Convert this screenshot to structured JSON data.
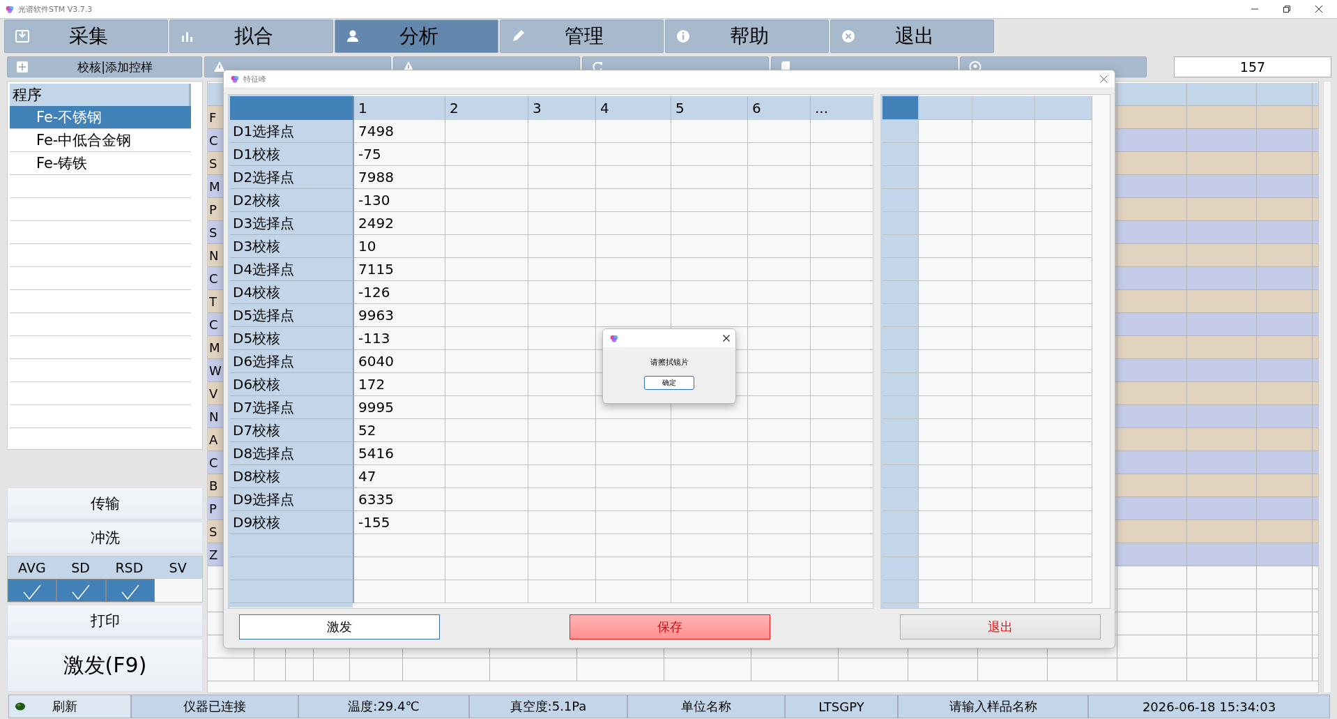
{
  "window": {
    "title": "光谱软件STM V3.7.3"
  },
  "main_tabs": [
    {
      "label": "采集",
      "selected": false
    },
    {
      "label": "拟合",
      "selected": false
    },
    {
      "label": "分析",
      "selected": true
    },
    {
      "label": "管理",
      "selected": false
    },
    {
      "label": "帮助",
      "selected": false
    },
    {
      "label": "退出",
      "selected": false
    }
  ],
  "toolbar": {
    "add_button": "校核|添加控样",
    "count": "157"
  },
  "program_list": {
    "header": "程序",
    "items": [
      {
        "label": "Fe-不锈钢",
        "selected": true
      },
      {
        "label": "Fe-中低合金钢",
        "selected": false
      },
      {
        "label": "Fe-铸铁",
        "selected": false
      }
    ]
  },
  "actions": [
    "传输",
    "冲洗"
  ],
  "stats": [
    {
      "label": "AVG",
      "checked": true
    },
    {
      "label": "SD",
      "checked": true
    },
    {
      "label": "RSD",
      "checked": true
    },
    {
      "label": "SV",
      "checked": false
    }
  ],
  "actions_lower": [
    "打印",
    "激发(F9)"
  ],
  "element_grid": {
    "row_labels": [
      "F",
      "C",
      "S",
      "M",
      "P",
      "S",
      "N",
      "C",
      "T",
      "C",
      "M",
      "W",
      "V",
      "N",
      "A",
      "C",
      "B",
      "P",
      "S",
      "Z"
    ]
  },
  "status_bar": {
    "refresh": "刷新",
    "items": [
      "仪器已连接",
      "温度:29.4℃",
      "真空度:5.1Pa",
      "单位名称",
      "LTSGPY",
      "请输入样品名称",
      "2026-06-18 15:34:03"
    ]
  },
  "peak_dialog": {
    "title": "特征峰",
    "columns": [
      "1",
      "2",
      "3",
      "4",
      "5",
      "6",
      "..."
    ],
    "rows": [
      {
        "label": "D1选择点",
        "value": "7498"
      },
      {
        "label": "D1校核",
        "value": "-75"
      },
      {
        "label": "D2选择点",
        "value": "7988"
      },
      {
        "label": "D2校核",
        "value": "-130"
      },
      {
        "label": "D3选择点",
        "value": "2492"
      },
      {
        "label": "D3校核",
        "value": "10"
      },
      {
        "label": "D4选择点",
        "value": "7115"
      },
      {
        "label": "D4校核",
        "value": "-126"
      },
      {
        "label": "D5选择点",
        "value": "9963"
      },
      {
        "label": "D5校核",
        "value": "-113"
      },
      {
        "label": "D6选择点",
        "value": "6040"
      },
      {
        "label": "D6校核",
        "value": "172"
      },
      {
        "label": "D7选择点",
        "value": "9995"
      },
      {
        "label": "D7校核",
        "value": "52"
      },
      {
        "label": "D8选择点",
        "value": "5416"
      },
      {
        "label": "D8校核",
        "value": "47"
      },
      {
        "label": "D9选择点",
        "value": "6335"
      },
      {
        "label": "D9校核",
        "value": "-155"
      }
    ],
    "buttons": [
      {
        "label": "激发",
        "kind": "plain"
      },
      {
        "label": "保存",
        "kind": "danger"
      },
      {
        "label": "退出",
        "kind": "exit"
      }
    ]
  },
  "message_box": {
    "message": "请擦拭镜片",
    "button": "确定"
  }
}
